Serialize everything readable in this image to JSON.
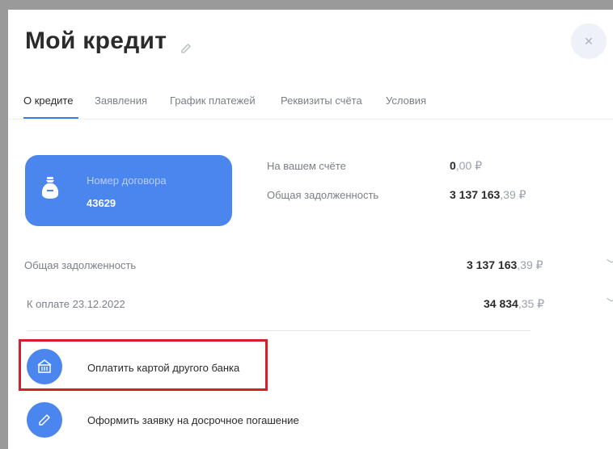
{
  "header": {
    "title": "Мой кредит",
    "close_icon": "close-icon",
    "edit_icon": "pencil-icon"
  },
  "tabs": [
    {
      "label": "О кредите",
      "active": true
    },
    {
      "label": "Заявления",
      "active": false
    },
    {
      "label": "График платежей",
      "active": false
    },
    {
      "label": "Реквизиты счёта",
      "active": false
    },
    {
      "label": "Условия",
      "active": false
    }
  ],
  "card": {
    "label": "Номер договора",
    "number": "43629",
    "icon": "money-bag-icon",
    "color": "#4b86ef"
  },
  "summary": {
    "balance_label": "На вашем счёте",
    "balance_int": "0",
    "balance_frac": ",00 ₽",
    "debt_label": "Общая задолженность",
    "debt_int": "3 137 163",
    "debt_frac": ",39 ₽"
  },
  "rows": [
    {
      "label": "Общая задолженность",
      "int": "3 137 163",
      "frac": ",39 ₽"
    },
    {
      "label": "К оплате 23.12.2022",
      "int": "34 834",
      "frac": ",35 ₽"
    }
  ],
  "actions": [
    {
      "label": "Оплатить картой другого банка",
      "icon": "bank-icon"
    },
    {
      "label": "Оформить заявку на досрочное погашение",
      "icon": "pencil-icon"
    }
  ],
  "colors": {
    "accent": "#4b86ef",
    "highlight": "#d3202a"
  }
}
